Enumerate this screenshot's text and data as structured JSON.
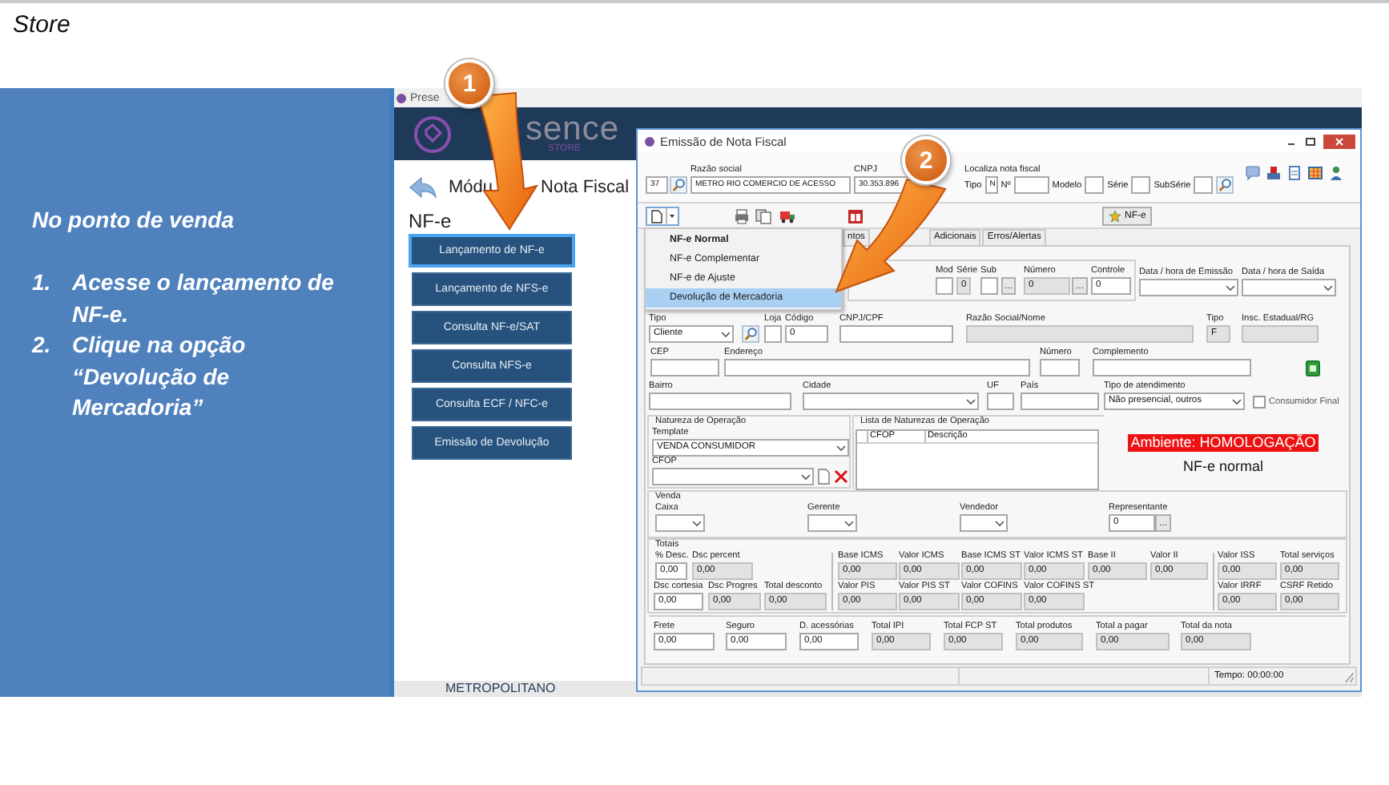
{
  "slide": {
    "header": "Store",
    "heading": "No ponto de venda",
    "steps": [
      {
        "number": "1.",
        "text": "Acesse o lançamento de NF-e."
      },
      {
        "number": "2.",
        "text": "Clique na opção “Devolução de Mercadoria”"
      }
    ]
  },
  "callouts": [
    {
      "number": "1"
    },
    {
      "number": "2"
    }
  ],
  "app": {
    "title": "Prese",
    "logo": [
      "sence"
    ],
    "logo_subtitle": "STORE",
    "module_title": [
      "Módu",
      "Nota Fiscal"
    ],
    "section": "NF-e",
    "sidebar": [
      {
        "label": "Lançamento de NF-e",
        "selected": true
      },
      {
        "label": "Lançamento de NFS-e",
        "selected": false
      },
      {
        "label": "Consulta NF-e/SAT",
        "selected": false
      },
      {
        "label": "Consulta NFS-e",
        "selected": false
      },
      {
        "label": "Consulta ECF / NFC-e",
        "selected": false
      },
      {
        "label": "Emissão de Devolução",
        "selected": false
      }
    ],
    "footer": "METROPOLITANO"
  },
  "dialog": {
    "title": "Emissão de Nota Fiscal",
    "header": [
      {
        "kind": "text",
        "value": "37",
        "readonly": false
      },
      {
        "kind": "search"
      },
      {
        "kind": "text",
        "label": "Razão social",
        "value": "METRO RIO COMERCIO DE ACESSO",
        "readonly": false
      },
      {
        "kind": "text",
        "label": "CNPJ",
        "value": "30.353.896",
        "readonly": false
      }
    ],
    "locate": {
      "title": "Localiza nota fiscal",
      "fields": [
        {
          "label": "Tipo",
          "value": "N"
        },
        {
          "label": "Nº"
        },
        {
          "label": "Modelo"
        },
        {
          "label": "Série"
        },
        {
          "label": "SubSérie"
        }
      ]
    },
    "nfe_button": "NF-e",
    "new_menu": [
      {
        "label": "NF-e Normal",
        "default": true,
        "selected": false
      },
      {
        "label": "NF-e Complementar",
        "default": false,
        "selected": false
      },
      {
        "label": "NF-e de Ajuste",
        "default": false,
        "selected": false
      },
      {
        "label": "Devolução de Mercadoria",
        "default": false,
        "selected": true
      }
    ],
    "tabs": [
      {
        "label": "ntos",
        "selected": false
      },
      {
        "label": "Adicionais",
        "selected": false
      },
      {
        "label": "Erros/Alertas",
        "selected": false
      }
    ],
    "document": [
      {
        "kind": "text",
        "label": "Mod",
        "readonly": false
      },
      {
        "kind": "text",
        "label": "Série",
        "value": "0",
        "readonly": true
      },
      {
        "kind": "text",
        "label": "Sub",
        "readonly": false
      },
      {
        "kind": "button",
        "value": "..."
      },
      {
        "kind": "text",
        "label": "Número",
        "value": "0",
        "readonly": true
      },
      {
        "kind": "button",
        "value": "..."
      },
      {
        "kind": "text",
        "label": "Controle",
        "value": "0",
        "readonly": false
      },
      {
        "kind": "select",
        "label": "Data / hora de Emissão",
        "readonly": false
      },
      {
        "kind": "select",
        "label": "Data / hora de Saída",
        "readonly": false
      }
    ],
    "customer": [
      [
        {
          "kind": "select",
          "label": "Tipo",
          "value": "Cliente",
          "readonly": false
        },
        {
          "kind": "search"
        },
        {
          "kind": "text",
          "label": "Loja",
          "readonly": false
        },
        {
          "kind": "text",
          "label": "Código",
          "value": "0",
          "readonly": false
        },
        {
          "kind": "text",
          "label": "CNPJ/CPF",
          "readonly": false
        },
        {
          "kind": "text",
          "label": "Razão Social/Nome",
          "readonly": true
        },
        {
          "kind": "text",
          "label": "Tipo",
          "value": "F",
          "readonly": true
        },
        {
          "kind": "text",
          "label": "Insc. Estadual/RG",
          "readonly": true
        }
      ],
      [
        {
          "kind": "text",
          "label": "CEP",
          "readonly": false
        },
        {
          "kind": "text",
          "label": "Endereço",
          "readonly": false
        },
        {
          "kind": "text",
          "label": "Número",
          "readonly": false
        },
        {
          "kind": "text",
          "label": "Complemento",
          "readonly": false
        },
        {
          "kind": "money"
        }
      ],
      [
        {
          "kind": "text",
          "label": "Bairro",
          "readonly": false
        },
        {
          "kind": "select",
          "label": "Cidade",
          "readonly": false
        },
        {
          "kind": "text",
          "label": "UF",
          "readonly": false
        },
        {
          "kind": "text",
          "label": "País",
          "readonly": false
        },
        {
          "kind": "select",
          "label": "Tipo de atendimento",
          "value": "Não presencial, outros",
          "readonly": false
        },
        {
          "kind": "checkbox",
          "label": "Consumidor Final",
          "checked": false
        }
      ]
    ],
    "natureza": {
      "title": "Natureza de Operação",
      "fields": [
        {
          "kind": "select",
          "label": "Template",
          "value": "VENDA CONSUMIDOR",
          "readonly": false
        },
        {
          "kind": "select",
          "label": "CFOP",
          "readonly": false
        }
      ]
    },
    "naturezas_list": {
      "title": "Lista de Naturezas de Operação",
      "columns": [
        "CFOP",
        "Descrição"
      ]
    },
    "environment": {
      "label": "Ambiente: HOMOLOGAÇÃO",
      "mode": "NF-e normal"
    },
    "venda": {
      "title": "Venda",
      "fields": [
        {
          "kind": "select",
          "label": "Caixa",
          "readonly": false
        },
        {
          "kind": "select",
          "label": "Gerente",
          "readonly": false
        },
        {
          "kind": "select",
          "label": "Vendedor",
          "readonly": false
        },
        {
          "kind": "text",
          "label": "Representante",
          "value": "0",
          "readonly": false
        },
        {
          "kind": "button",
          "value": "..."
        }
      ]
    },
    "totais": {
      "title": "Totais",
      "groups": [
        {
          "rows": [
            [
              {
                "kind": "text",
                "label": "% Desc.",
                "value": "0,00",
                "readonly": false
              },
              {
                "kind": "text",
                "label": "Dsc percent",
                "value": "0,00",
                "readonly": true
              }
            ],
            [
              {
                "kind": "text",
                "label": "Dsc cortesia",
                "value": "0,00",
                "readonly": false
              },
              {
                "kind": "text",
                "label": "Dsc Progres",
                "value": "0,00",
                "readonly": true
              },
              {
                "kind": "text",
                "label": "Total desconto",
                "value": "0,00",
                "readonly": true
              }
            ]
          ]
        },
        {
          "rows": [
            [
              {
                "kind": "text",
                "label": "Base ICMS",
                "value": "0,00",
                "readonly": true
              },
              {
                "kind": "text",
                "label": "Valor ICMS",
                "value": "0,00",
                "readonly": true
              },
              {
                "kind": "text",
                "label": "Base ICMS ST",
                "value": "0,00",
                "readonly": true
              },
              {
                "kind": "text",
                "label": "Valor ICMS ST",
                "value": "0,00",
                "readonly": true
              },
              {
                "kind": "text",
                "label": "Base II",
                "value": "0,00",
                "readonly": true
              },
              {
                "kind": "text",
                "label": "Valor II",
                "value": "0,00",
                "readonly": true
              }
            ],
            [
              {
                "kind": "text",
                "label": "Valor PIS",
                "value": "0,00",
                "readonly": true
              },
              {
                "kind": "text",
                "label": "Valor PIS ST",
                "value": "0,00",
                "readonly": true
              },
              {
                "kind": "text",
                "label": "Valor COFINS",
                "value": "0,00",
                "readonly": true
              },
              {
                "kind": "text",
                "label": "Valor COFINS ST",
                "value": "0,00",
                "readonly": true
              }
            ]
          ]
        },
        {
          "rows": [
            [
              {
                "kind": "text",
                "label": "Valor ISS",
                "value": "0,00",
                "readonly": true
              },
              {
                "kind": "text",
                "label": "Total serviços",
                "value": "0,00",
                "readonly": true
              }
            ],
            [
              {
                "kind": "text",
                "label": "Valor IRRF",
                "value": "0,00",
                "readonly": true
              },
              {
                "kind": "text",
                "label": "CSRF Retido",
                "value": "0,00",
                "readonly": true
              }
            ]
          ]
        }
      ]
    },
    "totals": [
      {
        "kind": "text",
        "label": "Frete",
        "value": "0,00",
        "readonly": false
      },
      {
        "kind": "text",
        "label": "Seguro",
        "value": "0,00",
        "readonly": false
      },
      {
        "kind": "text",
        "label": "D. acessórias",
        "value": "0,00",
        "readonly": false
      },
      {
        "kind": "text",
        "label": "Total IPI",
        "value": "0,00",
        "readonly": true
      },
      {
        "kind": "text",
        "label": "Total FCP ST",
        "value": "0,00",
        "readonly": true
      },
      {
        "kind": "text",
        "label": "Total produtos",
        "value": "0,00",
        "readonly": true
      },
      {
        "kind": "text",
        "label": "Total a pagar",
        "value": "0,00",
        "readonly": true
      },
      {
        "kind": "text",
        "label": "Total da nota",
        "value": "0,00",
        "readonly": true
      }
    ],
    "status_bar": {
      "time": "Tempo: 00:00:00"
    }
  }
}
